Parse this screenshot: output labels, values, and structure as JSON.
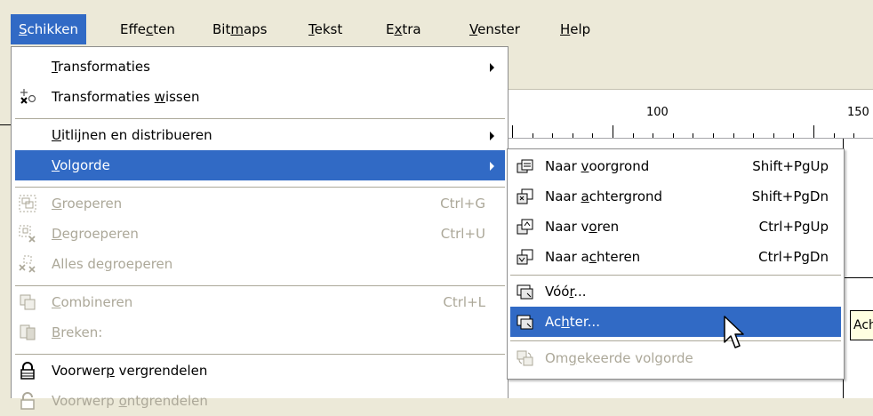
{
  "menubar": {
    "items": [
      {
        "pre": "",
        "ul": "S",
        "post": "chikken"
      },
      {
        "pre": "Effe",
        "ul": "c",
        "post": "ten"
      },
      {
        "pre": "Bit",
        "ul": "m",
        "post": "aps"
      },
      {
        "pre": "",
        "ul": "T",
        "post": "ekst"
      },
      {
        "pre": "E",
        "ul": "x",
        "post": "tra"
      },
      {
        "pre": "",
        "ul": "V",
        "post": "enster"
      },
      {
        "pre": "",
        "ul": "H",
        "post": "elp"
      }
    ]
  },
  "ruler": {
    "label_100": "100",
    "label_150": "150"
  },
  "menu": {
    "items": [
      {
        "pre": "",
        "ul": "T",
        "post": "ransformaties"
      },
      {
        "pre": "Transformaties ",
        "ul": "w",
        "post": "issen"
      },
      {
        "pre": "",
        "ul": "U",
        "post": "itlijnen en distribueren"
      },
      {
        "pre": "",
        "ul": "V",
        "post": "olgorde"
      },
      {
        "pre": "",
        "ul": "G",
        "post": "roeperen",
        "shortcut": "Ctrl+G"
      },
      {
        "pre": "",
        "ul": "D",
        "post": "egroeperen",
        "shortcut": "Ctrl+U"
      },
      {
        "pre": "Alles de",
        "ul": "g",
        "post": "roeperen"
      },
      {
        "pre": "",
        "ul": "C",
        "post": "ombineren",
        "shortcut": "Ctrl+L"
      },
      {
        "pre": "",
        "ul": "B",
        "post": "reken:"
      },
      {
        "pre": "Voorwer",
        "ul": "p",
        "post": " vergrendelen"
      },
      {
        "pre": "Voorwerp ",
        "ul": "o",
        "post": "ntgrendelen"
      }
    ]
  },
  "submenu": {
    "items": [
      {
        "pre": "Naar ",
        "ul": "v",
        "post": "oorgrond",
        "shortcut": "Shift+PgUp"
      },
      {
        "pre": "Naar ",
        "ul": "a",
        "post": "chtergrond",
        "shortcut": "Shift+PgDn"
      },
      {
        "pre": "Naar v",
        "ul": "o",
        "post": "ren",
        "shortcut": "Ctrl+PgUp"
      },
      {
        "pre": "Naar a",
        "ul": "c",
        "post": "hteren",
        "shortcut": "Ctrl+PgDn"
      },
      {
        "pre": "Vóó",
        "ul": "r",
        "post": "..."
      },
      {
        "pre": "Ac",
        "ul": "h",
        "post": "ter..."
      },
      {
        "pre": "Om",
        "ul": "g",
        "post": "ekeerde volgorde"
      }
    ]
  },
  "tooltip": {
    "text": "Ach"
  },
  "colors": {
    "highlight": "#316ac5",
    "menu_bg": "#ffffff",
    "chrome": "#ece9d8",
    "disabled_text": "#aca899"
  }
}
